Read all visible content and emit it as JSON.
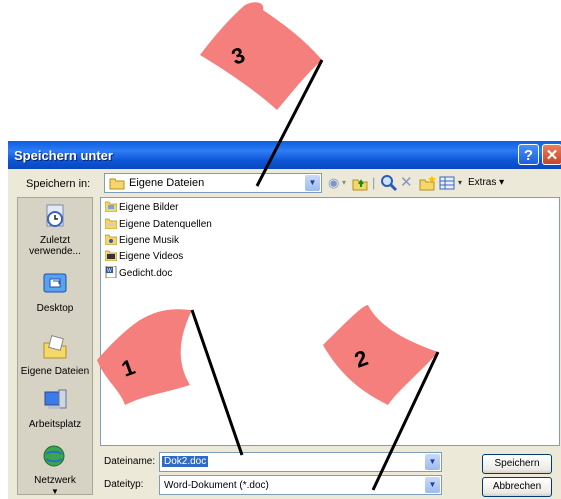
{
  "window": {
    "title": "Speichern unter",
    "help": "?",
    "close": "✕"
  },
  "toolbar": {
    "save_in_label": "Speichern in:",
    "folder": "Eigene Dateien",
    "extras": "Extras"
  },
  "places": [
    {
      "label": "Zuletzt verwende...",
      "icon": "recent-icon"
    },
    {
      "label": "Desktop",
      "icon": "desktop-icon"
    },
    {
      "label": "Eigene Dateien",
      "icon": "my-documents-icon"
    },
    {
      "label": "Arbeitsplatz",
      "icon": "my-computer-icon"
    },
    {
      "label": "Netzwerk",
      "icon": "network-icon"
    }
  ],
  "files": [
    {
      "name": "Eigene Bilder",
      "type": "folder"
    },
    {
      "name": "Eigene Datenquellen",
      "type": "folder"
    },
    {
      "name": "Eigene Musik",
      "type": "folder"
    },
    {
      "name": "Eigene Videos",
      "type": "folder"
    },
    {
      "name": "Gedicht.doc",
      "type": "word-doc"
    }
  ],
  "bottom": {
    "filename_label": "Dateiname:",
    "filename_value": "Dok2.doc",
    "filetype_label": "Dateityp:",
    "filetype_value": "Word-Dokument (*.doc)",
    "save_button": "Speichern",
    "cancel_button": "Abbrechen"
  },
  "annotations": [
    {
      "number": "1"
    },
    {
      "number": "2"
    },
    {
      "number": "3"
    }
  ],
  "colors": {
    "flag": "#f47f7c",
    "titlebar": "#0a5fe0",
    "selection": "#316ac5"
  }
}
